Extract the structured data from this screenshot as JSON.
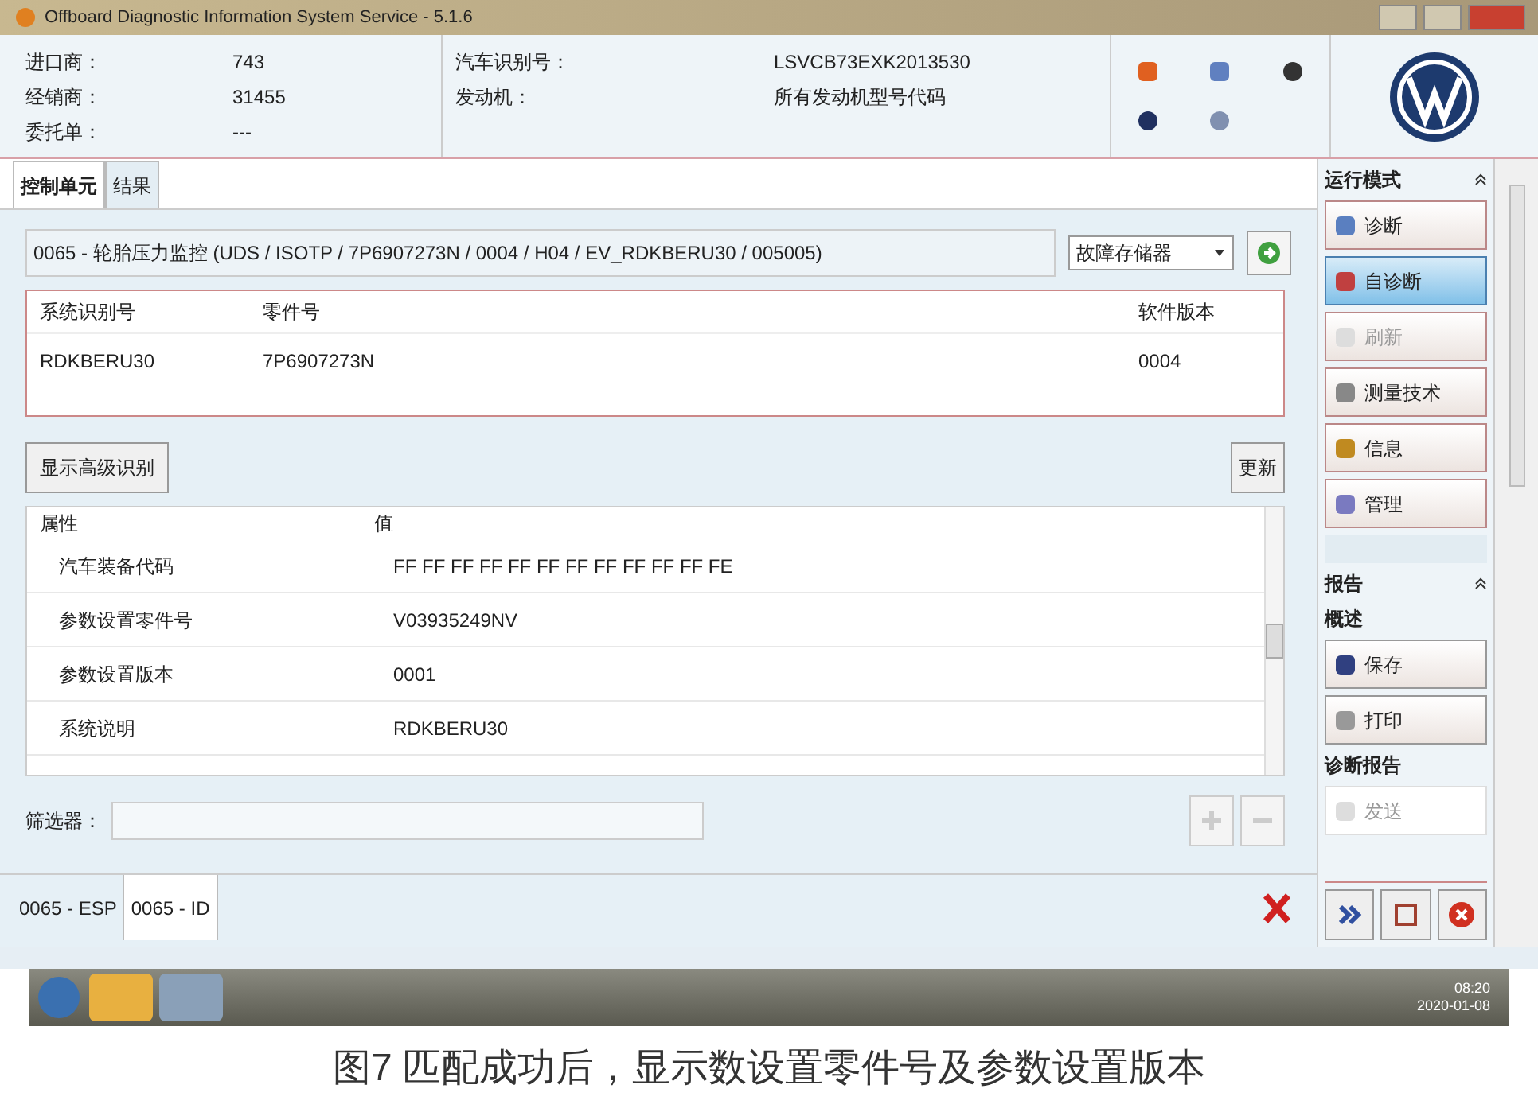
{
  "window": {
    "title": "Offboard Diagnostic Information System Service - 5.1.6"
  },
  "header": {
    "fields": [
      {
        "label": "进口商：",
        "value": "743"
      },
      {
        "label": "经销商：",
        "value": "31455"
      },
      {
        "label": "委托单：",
        "value": "---"
      }
    ],
    "vehicle": [
      {
        "label": "汽车识别号：",
        "value": "LSVCB73EXK2013530"
      },
      {
        "label": "发动机：",
        "value": "所有发动机型号代码"
      }
    ]
  },
  "tabs": [
    {
      "label": "控制单元",
      "selected": true
    },
    {
      "label": "结果",
      "selected": false
    }
  ],
  "control_unit": {
    "path": "0065 - 轮胎压力监控 (UDS / ISOTP / 7P6907273N / 0004 / H04 / EV_RDKBERU30 / 005005)",
    "dropdown": "故障存储器"
  },
  "id_table": {
    "columns": [
      "系统识别号",
      "零件号",
      "软件版本"
    ],
    "rows": [
      [
        "RDKBERU30",
        "7P6907273N",
        "0004"
      ]
    ]
  },
  "advanced_button": "显示高级识别",
  "update_button": "更新",
  "attributes": {
    "columns": [
      "属性",
      "值"
    ],
    "rows": [
      [
        "汽车装备代码",
        "FF FF FF FF FF FF FF FF FF FF FF FE"
      ],
      [
        "参数设置零件号",
        "V03935249NV"
      ],
      [
        "参数设置版本",
        "0001"
      ],
      [
        "系统说明",
        "RDKBERU30"
      ]
    ]
  },
  "filter": {
    "label": "筛选器："
  },
  "bottom_tabs": [
    {
      "label": "0065 - ESP",
      "selected": false
    },
    {
      "label": "0065 - ID",
      "selected": true
    }
  ],
  "sidebar": {
    "mode_title": "运行模式",
    "modes": [
      {
        "label": "诊断",
        "selected": false,
        "disabled": false
      },
      {
        "label": "自诊断",
        "selected": true,
        "disabled": false
      },
      {
        "label": "刷新",
        "selected": false,
        "disabled": true
      },
      {
        "label": "测量技术",
        "selected": false,
        "disabled": false
      },
      {
        "label": "信息",
        "selected": false,
        "disabled": false
      },
      {
        "label": "管理",
        "selected": false,
        "disabled": false
      }
    ],
    "report_title": "报告",
    "overview": "概述",
    "report_buttons": [
      {
        "label": "保存",
        "disabled": false
      },
      {
        "label": "打印",
        "disabled": false
      }
    ],
    "diag_report": "诊断报告",
    "diag_buttons": [
      {
        "label": "发送",
        "disabled": true
      }
    ]
  },
  "taskbar": {
    "time": "08:20",
    "date": "2020-01-08"
  },
  "caption": "图7 匹配成功后，显示数设置零件号及参数设置版本"
}
